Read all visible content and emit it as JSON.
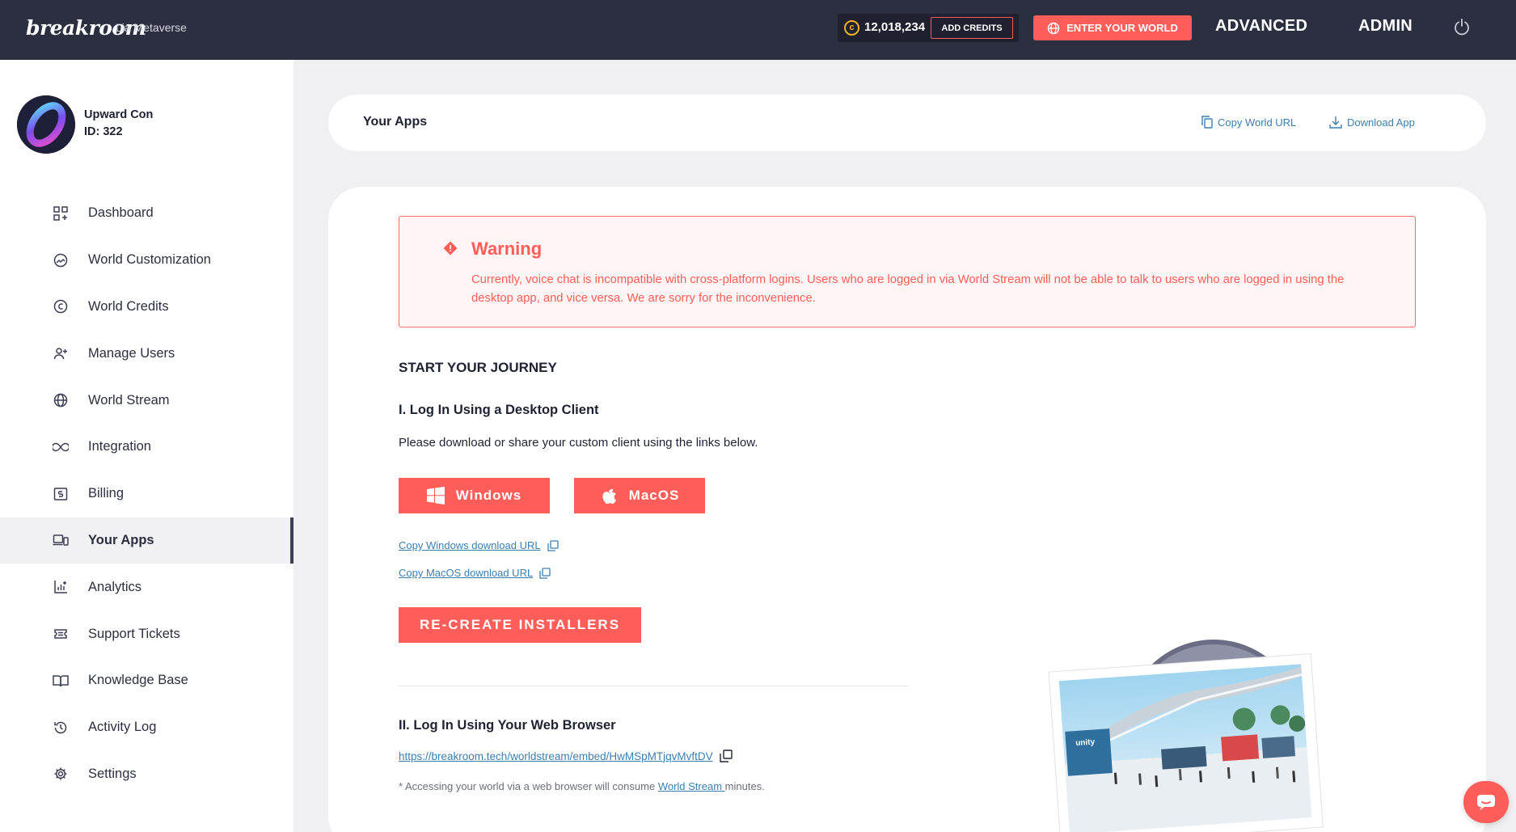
{
  "brand": {
    "logo_text": "breakroom",
    "org_name": "Lia Metaverse"
  },
  "topbar": {
    "credits": "12,018,234",
    "add_credits_label": "ADD CREDITS",
    "enter_world_label": "ENTER YOUR WORLD",
    "advanced_label": "ADVANCED",
    "admin_label": "ADMIN",
    "coin_icon": "coin-icon",
    "power_icon": "power-icon"
  },
  "profile": {
    "name": "Upward Con",
    "id_label": "ID: 322"
  },
  "sidebar": {
    "items": [
      {
        "label": "Dashboard",
        "icon": "dashboard-icon",
        "active": false
      },
      {
        "label": "World Customization",
        "icon": "palette-icon",
        "active": false
      },
      {
        "label": "World Credits",
        "icon": "credits-icon",
        "active": false
      },
      {
        "label": "Manage Users",
        "icon": "add-user-icon",
        "active": false
      },
      {
        "label": "World Stream",
        "icon": "globe-icon",
        "active": false
      },
      {
        "label": "Integration",
        "icon": "infinity-icon",
        "active": false
      },
      {
        "label": "Billing",
        "icon": "billing-icon",
        "active": false
      },
      {
        "label": "Your Apps",
        "icon": "devices-icon",
        "active": true
      },
      {
        "label": "Analytics",
        "icon": "analytics-icon",
        "active": false
      },
      {
        "label": "Support Tickets",
        "icon": "ticket-icon",
        "active": false
      },
      {
        "label": "Knowledge Base",
        "icon": "book-icon",
        "active": false
      },
      {
        "label": "Activity Log",
        "icon": "history-icon",
        "active": false
      },
      {
        "label": "Settings",
        "icon": "gear-icon",
        "active": false
      }
    ]
  },
  "header": {
    "title": "Your Apps",
    "copy_world_url": "Copy World URL",
    "download_app": "Download App"
  },
  "warning": {
    "title": "Warning",
    "text": "Currently, voice chat is incompatible with cross-platform logins. Users who are logged in via World Stream will not be able to talk to users who are logged in using the desktop app, and vice versa. We are sorry for the inconvenience."
  },
  "journey": {
    "heading": "START YOUR JOURNEY",
    "desktop_heading": "I. Log In Using a Desktop Client",
    "desktop_text": "Please download or share your custom client using the links below.",
    "windows_label": "Windows",
    "macos_label": "MacOS",
    "copy_windows": "Copy Windows download URL",
    "copy_macos": "Copy MacOS download URL",
    "recreate_label": "RE-CREATE INSTALLERS",
    "web_heading": "II. Log In Using Your Web Browser",
    "web_url": "https://breakroom.tech/worldstream/embed/HwMSpMTjqvMvftDV",
    "footnote_prefix": "* Accessing your world via a web browser will consume ",
    "footnote_link": "World Stream ",
    "footnote_suffix": "minutes."
  },
  "colors": {
    "accent": "#ff5d5a",
    "topbar": "#2c2f40",
    "link": "#3b7fb0"
  }
}
